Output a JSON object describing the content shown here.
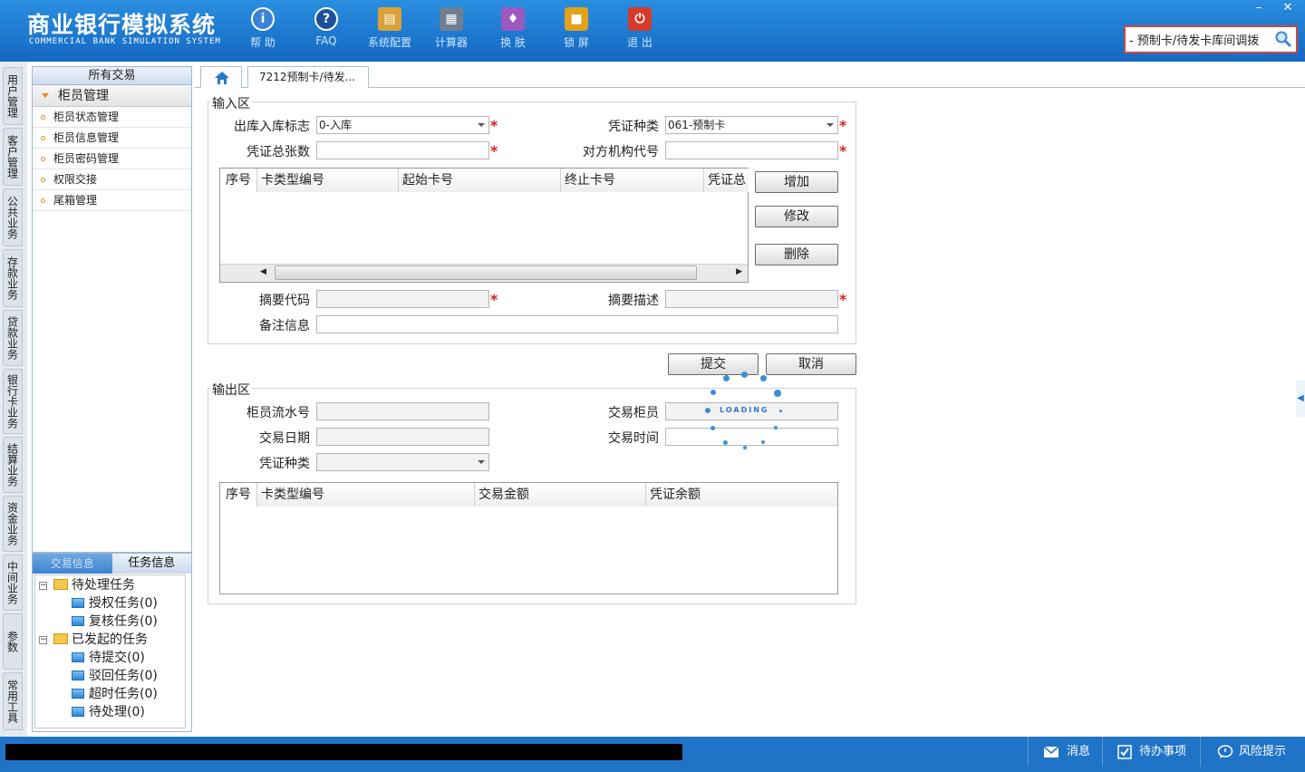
{
  "app": {
    "title_cn": "商业银行模拟系统",
    "title_en": "COMMERCIAL BANK SIMULATION SYSTEM"
  },
  "toolbar": [
    {
      "label": "帮 助",
      "icon": "info-icon",
      "color": "#3b82d8"
    },
    {
      "label": "FAQ",
      "icon": "question-icon",
      "color": "#1e4f9a"
    },
    {
      "label": "系统配置",
      "icon": "toolbox-icon",
      "color": "#d9a23a"
    },
    {
      "label": "计算器",
      "icon": "calculator-icon",
      "color": "#6f7f90"
    },
    {
      "label": "换 肤",
      "icon": "shirt-icon",
      "color": "#9b59c0"
    },
    {
      "label": "锁 屏",
      "icon": "lock-icon",
      "color": "#e3a21a"
    },
    {
      "label": "退 出",
      "icon": "power-icon",
      "color": "#d63a2a"
    }
  ],
  "window": {
    "minimize": "–",
    "close": "✕"
  },
  "search": {
    "value": "- 预制卡/待发卡库间调拨"
  },
  "side_tabs": [
    "用户管理",
    "客户管理",
    "公共业务",
    "存款业务",
    "贷款业务",
    "银行卡业务",
    "结算业务",
    "资金业务",
    "中间业务",
    "参数",
    "常用工具"
  ],
  "nav": {
    "header": "所有交易",
    "group": "柜员管理",
    "items": [
      "柜员状态管理",
      "柜员信息管理",
      "柜员密码管理",
      "权限交接",
      "尾箱管理"
    ]
  },
  "task_panel": {
    "tabs": [
      "交易信息",
      "任务信息"
    ],
    "tree": [
      {
        "label": "待处理任务",
        "level": 0
      },
      {
        "label": "授权任务(0)",
        "level": 1
      },
      {
        "label": "复核任务(0)",
        "level": 1
      },
      {
        "label": "已发起的任务",
        "level": 0
      },
      {
        "label": "待提交(0)",
        "level": 1
      },
      {
        "label": "驳回任务(0)",
        "level": 1
      },
      {
        "label": "超时任务(0)",
        "level": 1
      },
      {
        "label": "待处理(0)",
        "level": 1
      }
    ]
  },
  "tabs": {
    "active": "7212预制卡/待发..."
  },
  "input_area": {
    "title": "输入区",
    "fields": {
      "direction_label": "出库入库标志",
      "direction_value": "0-入库",
      "voucher_type_label": "凭证种类",
      "voucher_type_value": "061-预制卡",
      "total_label": "凭证总张数",
      "total_value": "",
      "counterparty_label": "对方机构代号",
      "counterparty_value": "",
      "summary_code_label": "摘要代码",
      "summary_desc_label": "摘要描述",
      "remark_label": "备注信息"
    },
    "grid_columns": [
      "序号",
      "卡类型编号",
      "起始卡号",
      "终止卡号",
      "凭证总"
    ],
    "buttons": {
      "add": "增加",
      "edit": "修改",
      "delete": "删除"
    }
  },
  "actions": {
    "submit": "提交",
    "cancel": "取消"
  },
  "loading_text": "LOADING",
  "output_area": {
    "title": "输出区",
    "fields": {
      "teller_serial_label": "柜员流水号",
      "trade_teller_label": "交易柜员",
      "trade_date_label": "交易日期",
      "trade_time_label": "交易时间",
      "voucher_type_label": "凭证种类"
    },
    "grid_columns": [
      "序号",
      "卡类型编号",
      "交易金额",
      "凭证余额"
    ]
  },
  "statusbar": {
    "items": [
      {
        "label": "消息",
        "icon": "mail-icon"
      },
      {
        "label": "待办事项",
        "icon": "checkbox-icon"
      },
      {
        "label": "风险提示",
        "icon": "speech-bubble-icon"
      }
    ]
  }
}
